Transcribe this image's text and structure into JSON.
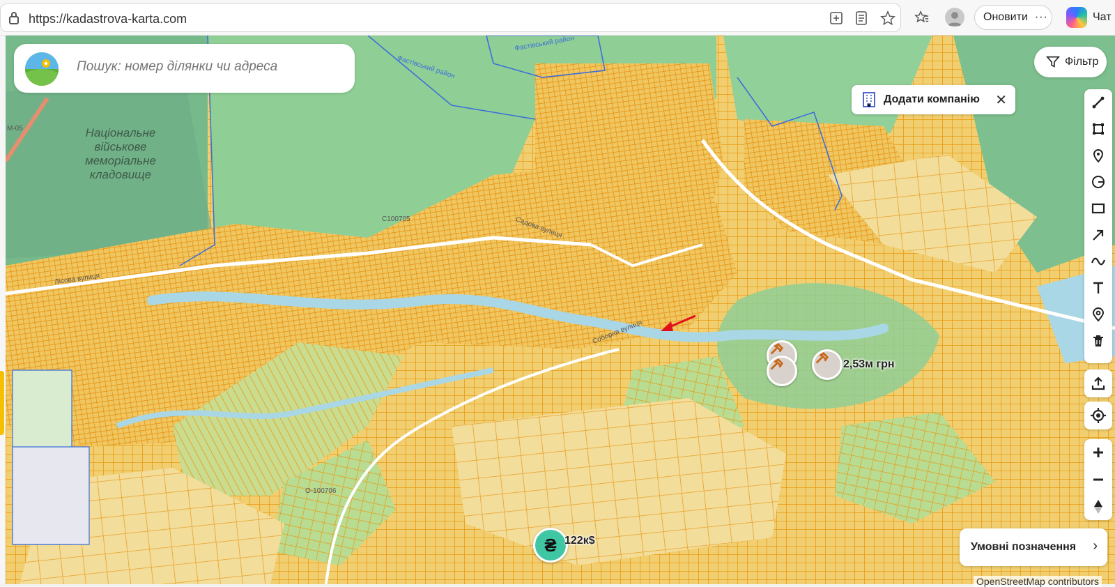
{
  "browser": {
    "url": "https://kadastrova-karta.com",
    "update_label": "Оновити",
    "more_label": "···",
    "chat_label": "Чат"
  },
  "search": {
    "placeholder": "Пошук: номер ділянки чи адреса"
  },
  "filter": {
    "label": "Фільтр"
  },
  "company_banner": {
    "label": "Додати компанію",
    "close": "✕"
  },
  "map_labels": {
    "cemetery": "Національне військове меморіальне кладовище",
    "district": "Фастівський район",
    "district_2": "Фастівський район",
    "road_m05": "М-05",
    "road_c100705": "С100705",
    "road_o100706": "О-100706",
    "street_1": "Лісова вулиця",
    "street_2": "Садова вулиця",
    "street_3": "Соборна вулиця"
  },
  "markers": {
    "auction_price": "2,53м грн",
    "sale_price": "122к$",
    "sale_symbol": "₴"
  },
  "legend": {
    "label": "Умовні позначення",
    "chevron": "›"
  },
  "attribution": "OpenStreetMap contributors",
  "colors": {
    "plot_fill": "#f1cf70",
    "plot_outline": "#e89a14",
    "forest": "#8fcf95",
    "forest_dark": "#76b98a",
    "water": "#a9d7e6",
    "boundary": "#3d6fd8"
  }
}
